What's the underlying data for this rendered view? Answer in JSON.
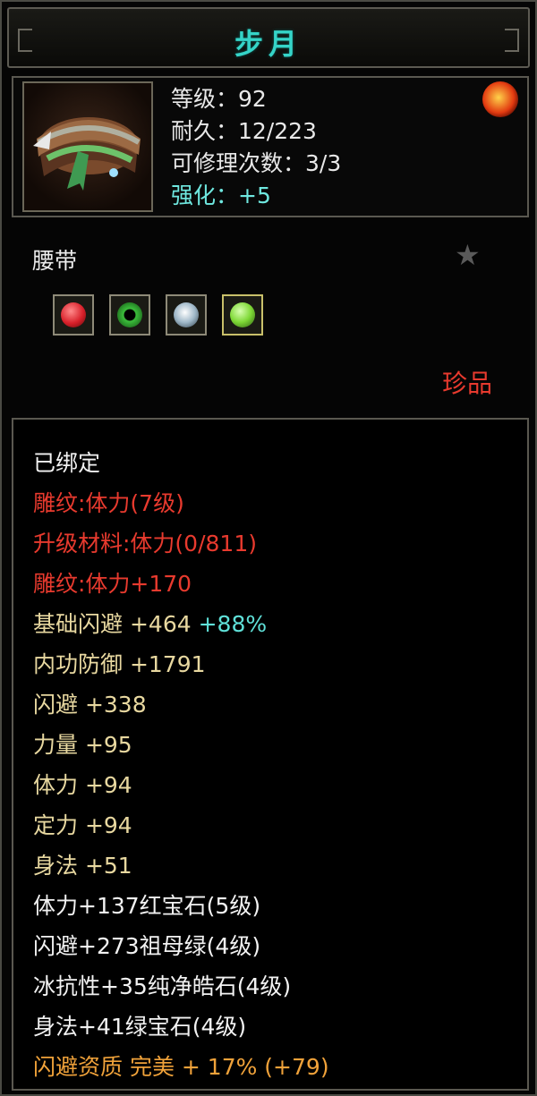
{
  "title": "步月",
  "item": {
    "level": "等级：92",
    "durability": "耐久：12/223",
    "repair_count": "可修理次数：3/3",
    "enhance": "强化：+5",
    "type": "腰带",
    "rarity": "珍品",
    "icon": "belt-icon",
    "badge": "flame-badge-icon"
  },
  "gems": [
    {
      "name": "red-gem-icon",
      "color": "#d8202a"
    },
    {
      "name": "green-jade-icon",
      "color": "#3cbf3c"
    },
    {
      "name": "white-crystal-icon",
      "color": "#c8d8e8"
    },
    {
      "name": "green-gem-icon",
      "color": "#7ed836"
    }
  ],
  "attributes": {
    "bound": "已绑定",
    "engrave": "雕纹:体力(7级)",
    "upgrade": "升级材料:体力(0/811)",
    "engrave_bonus": "雕纹:体力+170",
    "base_dodge_label": "基础闪避",
    "base_dodge_value": "+464",
    "base_dodge_pct": "+88%",
    "inner_def": "内功防御  +1791",
    "dodge": "闪避  +338",
    "strength": "力量  +95",
    "vitality": "体力  +94",
    "focus": "定力  +94",
    "agility": "身法  +51",
    "gem1": "体力+137红宝石(5级)",
    "gem2": "闪避+273祖母绿(4级)",
    "gem3": "冰抗性+35纯净皓石(4级)",
    "gem4": "身法+41绿宝石(4级)",
    "quality": "闪避资质  完美  + 17% (+79)"
  },
  "colors": {
    "title": "#35d4c8",
    "red": "#e83a2e",
    "gold": "#e8d8a0",
    "orange": "#f0a23a",
    "cyan": "#5fe0d8"
  }
}
